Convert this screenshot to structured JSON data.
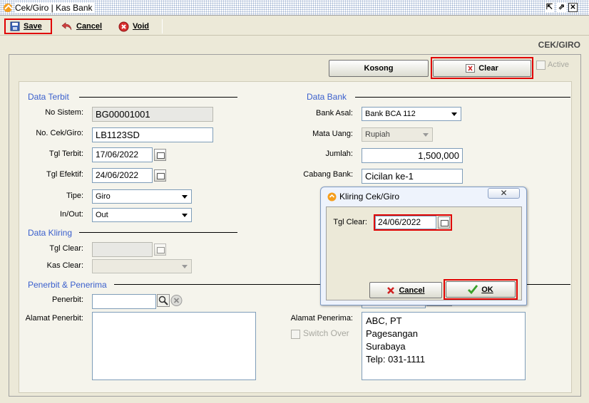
{
  "window": {
    "title": "Cek/Giro | Kas Bank",
    "restore_glyph": "⇱",
    "popout_glyph": "⇗",
    "close_glyph": "✕"
  },
  "toolbar": {
    "save_label": "Save",
    "cancel_label": "Cancel",
    "void_label": "Void"
  },
  "page_heading": "CEK/GIRO",
  "header_buttons": {
    "kosong_label": "Kosong",
    "clear_label": "Clear",
    "active_label": "Active"
  },
  "data_terbit": {
    "title": "Data Terbit",
    "no_sistem_label": "No Sistem:",
    "no_sistem_value": "BG00001001",
    "no_cek_label": "No. Cek/Giro:",
    "no_cek_value": "LB1123SD",
    "tgl_terbit_label": "Tgl Terbit:",
    "tgl_terbit_value": "17/06/2022",
    "tgl_efektif_label": "Tgl Efektif:",
    "tgl_efektif_value": "24/06/2022",
    "tipe_label": "Tipe:",
    "tipe_value": "Giro",
    "inout_label": "In/Out:",
    "inout_value": "Out"
  },
  "data_kliring": {
    "title": "Data Kliring",
    "tgl_clear_label": "Tgl Clear:",
    "tgl_clear_value": "",
    "kas_clear_label": "Kas Clear:",
    "kas_clear_value": ""
  },
  "data_bank": {
    "title": "Data Bank",
    "bank_asal_label": "Bank Asal:",
    "bank_asal_value": "Bank BCA 112",
    "mata_uang_label": "Mata Uang:",
    "mata_uang_value": "Rupiah",
    "jumlah_label": "Jumlah:",
    "jumlah_value": "1,500,000",
    "cabang_label": "Cabang Bank:",
    "cabang_value": "Cicilan ke-1"
  },
  "penerbit_penerima": {
    "title": "Penerbit & Penerima",
    "penerbit_label": "Penerbit:",
    "penerbit_value": "",
    "alamat_penerbit_label": "Alamat Penerbit:",
    "alamat_penerbit_value": "",
    "alamat_penerima_label": "Alamat Penerima:",
    "alamat_penerima_lines": [
      "ABC, PT",
      "Pagesangan",
      "Surabaya",
      "Telp: 031-1111"
    ],
    "switch_over_label": "Switch Over"
  },
  "dialog": {
    "title": "Kliring Cek/Giro",
    "close_glyph": "✕",
    "tgl_clear_label": "Tgl Clear:",
    "tgl_clear_value": "24/06/2022",
    "cancel_label": "Cancel",
    "ok_label": "OK"
  },
  "colors": {
    "highlight": "#E00000",
    "section_title": "#3A5FCD",
    "app_logo": "#F59E1E"
  }
}
